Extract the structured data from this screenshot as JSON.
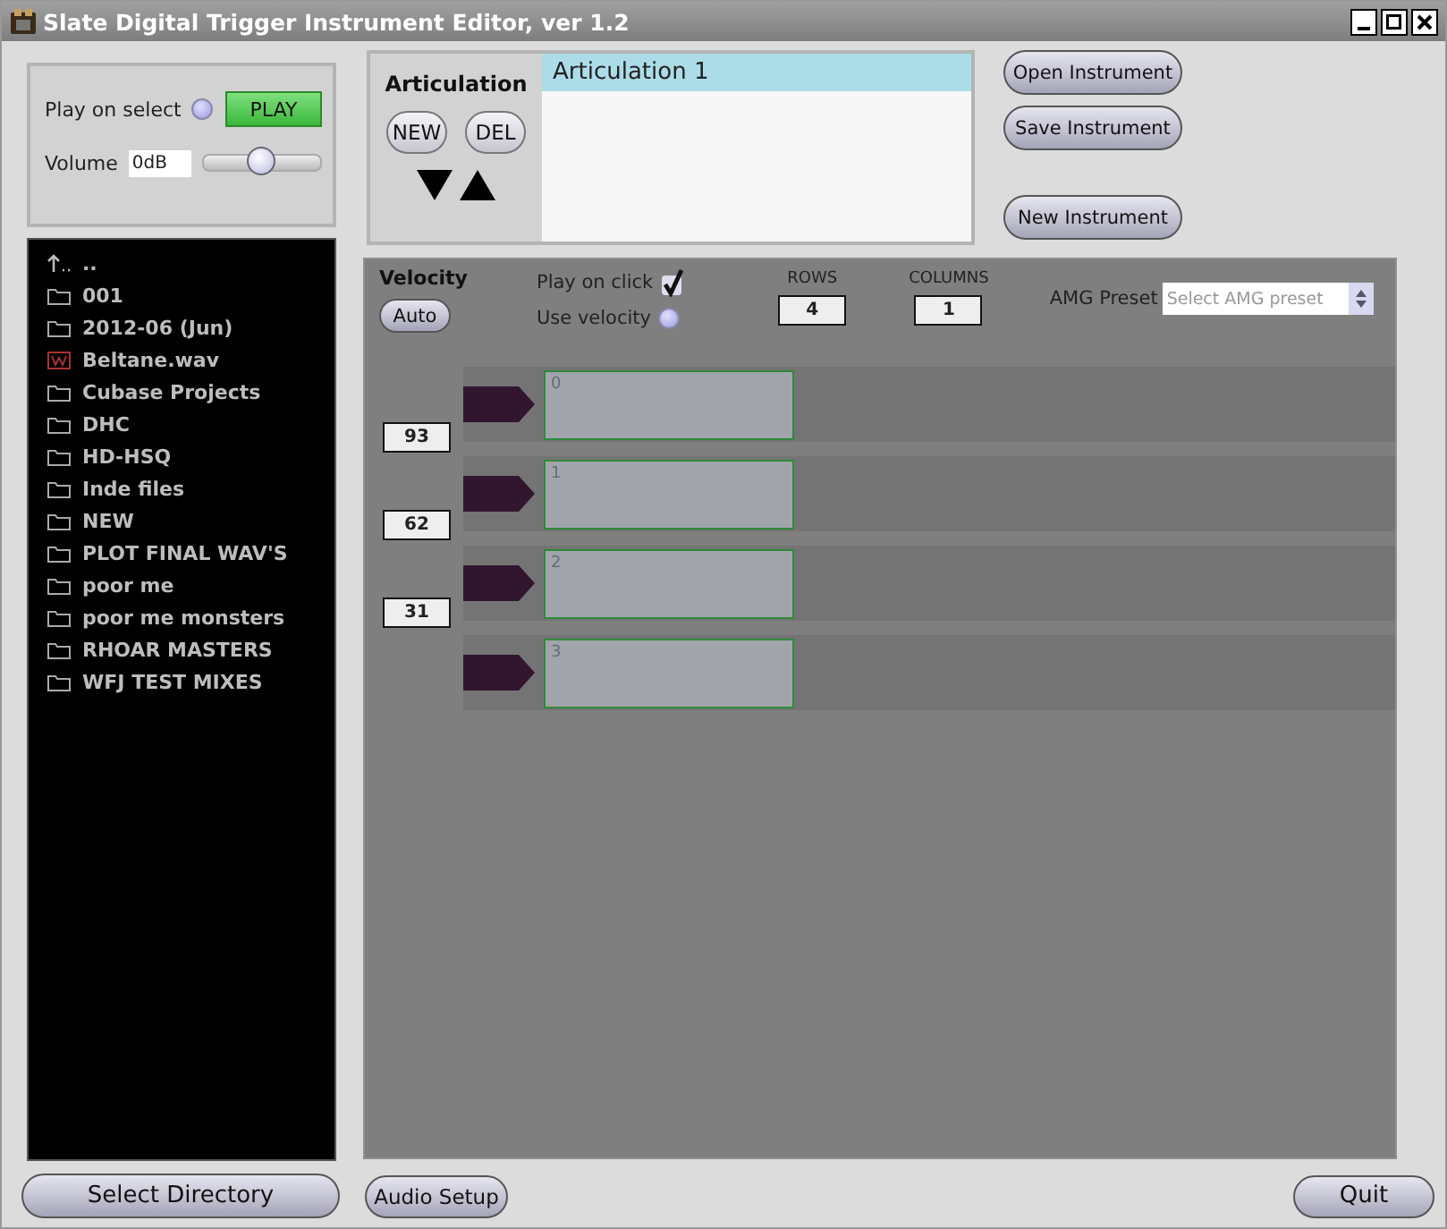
{
  "window": {
    "title": "Slate Digital Trigger Instrument Editor, ver 1.2"
  },
  "playback": {
    "play_on_select": {
      "label": "Play on select",
      "on": false
    },
    "play_button": "PLAY",
    "volume": {
      "label": "Volume",
      "value": "0dB",
      "level": 0.5
    }
  },
  "articulation": {
    "title": "Articulation",
    "buttons": [
      "NEW",
      "DEL"
    ],
    "items": [
      {
        "label": "Articulation 1",
        "selected": true
      }
    ]
  },
  "instrument_buttons": [
    "Open Instrument",
    "Save Instrument",
    "New Instrument"
  ],
  "files": [
    {
      "name": "..",
      "kind": "parent"
    },
    {
      "name": "001",
      "kind": "folder"
    },
    {
      "name": "2012-06 (Jun)",
      "kind": "folder"
    },
    {
      "name": "Beltane.wav",
      "kind": "wav"
    },
    {
      "name": "Cubase Projects",
      "kind": "folder"
    },
    {
      "name": "DHC",
      "kind": "folder"
    },
    {
      "name": "HD-HSQ",
      "kind": "folder"
    },
    {
      "name": "Inde files",
      "kind": "folder"
    },
    {
      "name": "NEW",
      "kind": "folder"
    },
    {
      "name": "PLOT FINAL WAV'S",
      "kind": "folder"
    },
    {
      "name": "poor me",
      "kind": "folder"
    },
    {
      "name": "poor me monsters",
      "kind": "folder"
    },
    {
      "name": "RHOAR MASTERS",
      "kind": "folder"
    },
    {
      "name": "WFJ TEST MIXES",
      "kind": "folder"
    }
  ],
  "velocity": {
    "title": "Velocity",
    "auto_button": "Auto",
    "play_on_click": {
      "label": "Play on click",
      "checked": true
    },
    "use_velocity": {
      "label": "Use velocity",
      "on": false
    },
    "rows": {
      "label": "ROWS",
      "value": "4"
    },
    "columns": {
      "label": "COLUMNS",
      "value": "1"
    },
    "amg_preset": {
      "label": "AMG Preset",
      "placeholder": "Select AMG preset"
    },
    "thresholds": [
      "93",
      "62",
      "31"
    ],
    "pads": [
      {
        "label": "0"
      },
      {
        "label": "1"
      },
      {
        "label": "2"
      },
      {
        "label": "3"
      }
    ]
  },
  "footer": {
    "select_directory": "Select Directory",
    "audio_setup": "Audio Setup",
    "quit": "Quit"
  }
}
